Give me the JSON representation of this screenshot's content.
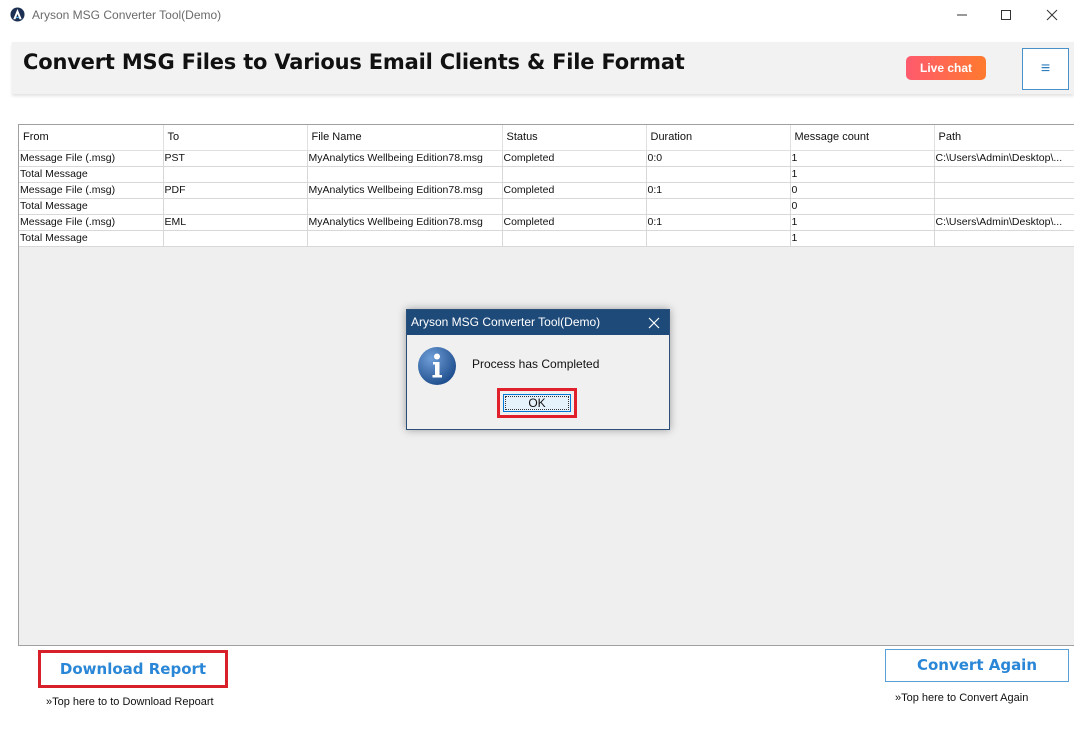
{
  "window": {
    "title": "Aryson MSG Converter Tool(Demo)",
    "icons": [
      "app-logo-icon",
      "minimize-icon",
      "maximize-icon",
      "close-icon"
    ]
  },
  "header": {
    "title": "Convert MSG Files to Various Email Clients & File Format",
    "live_chat_label": "Live chat",
    "menu_icon": "≡"
  },
  "table": {
    "columns": [
      "From",
      "To",
      "File Name",
      "Status",
      "Duration",
      "Message count",
      "Path"
    ],
    "rows": [
      [
        "Message File (.msg)",
        "PST",
        "MyAnalytics  Wellbeing Edition78.msg",
        "Completed",
        "0:0",
        "1",
        "C:\\Users\\Admin\\Desktop\\..."
      ],
      [
        "Total Message",
        "",
        "",
        "",
        "",
        "1",
        ""
      ],
      [
        "Message File (.msg)",
        "PDF",
        "MyAnalytics  Wellbeing Edition78.msg",
        "Completed",
        "0:1",
        "0",
        ""
      ],
      [
        "Total Message",
        "",
        "",
        "",
        "",
        "0",
        ""
      ],
      [
        "Message File (.msg)",
        "EML",
        "MyAnalytics  Wellbeing Edition78.msg",
        "Completed",
        "0:1",
        "1",
        "C:\\Users\\Admin\\Desktop\\..."
      ],
      [
        "Total Message",
        "",
        "",
        "",
        "",
        "1",
        ""
      ]
    ]
  },
  "dialog": {
    "title": "Aryson MSG Converter Tool(Demo)",
    "message": "Process has Completed",
    "ok_label": "OK",
    "icon": "info-icon"
  },
  "bottom": {
    "download_label": "Download Report",
    "download_hint": "»Top here to to Download Repoart",
    "convert_label": "Convert Again",
    "convert_hint": "»Top here to Convert Again"
  },
  "colors": {
    "accent": "#2a86d6",
    "highlight": "#d8202a",
    "dialog_title": "#1e4a7a",
    "live_chat_from": "#ff5a6e",
    "live_chat_to": "#ff7a2e"
  }
}
